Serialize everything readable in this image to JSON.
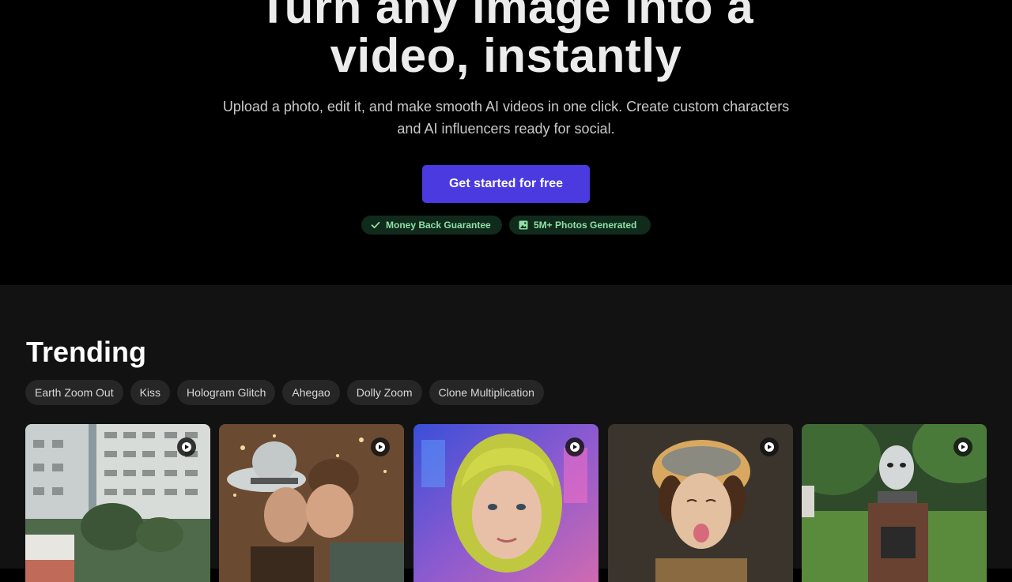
{
  "hero": {
    "title_line1": "Turn any image into a",
    "title_line2": "video, instantly",
    "subtitle_line1": "Upload a photo, edit it, and make smooth AI videos in one click. Create custom characters",
    "subtitle_line2": "and AI influencers ready for social.",
    "cta_label": "Get started for free",
    "badges": [
      {
        "label": "Money Back Guarantee",
        "icon": "check-icon"
      },
      {
        "label": "5M+ Photos Generated",
        "icon": "image-icon"
      }
    ]
  },
  "trending": {
    "title": "Trending",
    "chips": [
      "Earth Zoom Out",
      "Kiss",
      "Hologram Glitch",
      "Ahegao",
      "Dolly Zoom",
      "Clone Multiplication"
    ],
    "cards": [
      {
        "name": "card-earth-zoom-out",
        "icon": "play-icon"
      },
      {
        "name": "card-kiss",
        "icon": "play-icon"
      },
      {
        "name": "card-hologram-glitch",
        "icon": "play-icon"
      },
      {
        "name": "card-ahegao",
        "icon": "play-icon"
      },
      {
        "name": "card-dolly-zoom",
        "icon": "play-icon"
      }
    ]
  },
  "colors": {
    "accent": "#4a3ae0",
    "badge_bg": "#102a1c",
    "badge_text": "#8ee0a6",
    "section_bg": "#121212",
    "chip_bg": "#262626"
  }
}
